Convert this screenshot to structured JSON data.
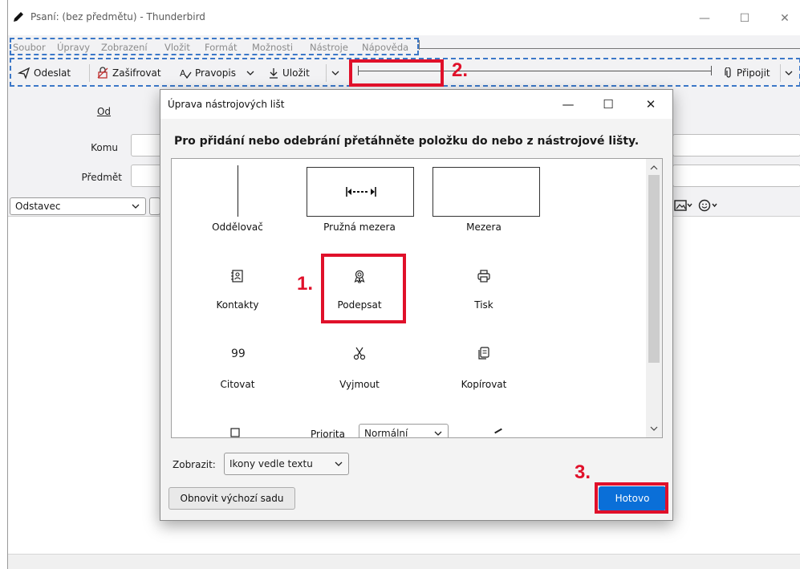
{
  "window": {
    "title": "Psaní: (bez předmětu) - Thunderbird",
    "minimize": "—",
    "maximize": "☐",
    "close": "✕"
  },
  "menubar": {
    "items": [
      "Soubor",
      "Úpravy",
      "Zobrazení",
      "Vložit",
      "Formát",
      "Možnosti",
      "Nástroje",
      "Nápověda"
    ]
  },
  "toolbar": {
    "send": "Odeslat",
    "encrypt": "Zašifrovat",
    "spelling": "Pravopis",
    "save": "Uložit",
    "attach": "Připojit"
  },
  "compose": {
    "from_label": "Od",
    "to_label": "Komu",
    "subject_label": "Předmět",
    "paragraph_select": "Odstavec"
  },
  "dialog": {
    "title": "Úprava nástrojových lišt",
    "minimize": "—",
    "maximize": "☐",
    "close": "✕",
    "instruction": "Pro přidání nebo odebrání přetáhněte položku do nebo z nástrojové lišty.",
    "items": [
      {
        "label": "Oddělovač",
        "icon": "separator-icon"
      },
      {
        "label": "Pružná mezera",
        "icon": "flexible-space-icon"
      },
      {
        "label": "Mezera",
        "icon": "space-icon"
      },
      {
        "label": "Kontakty",
        "icon": "contacts-icon"
      },
      {
        "label": "Podepsat",
        "icon": "sign-icon"
      },
      {
        "label": "Tisk",
        "icon": "print-icon"
      },
      {
        "label": "Citovat",
        "icon": "quote-icon"
      },
      {
        "label": "Vyjmout",
        "icon": "scissors-icon"
      },
      {
        "label": "Kopírovat",
        "icon": "copy-icon"
      }
    ],
    "partial_row_text": "Priorita",
    "partial_row_select": "Normální",
    "show_label": "Zobrazit:",
    "show_value": "Ikony vedle textu",
    "restore_button": "Obnovit výchozí sadu",
    "done_button": "Hotovo"
  },
  "annotations": {
    "step1": "1.",
    "step2": "2.",
    "step3": "3.",
    "color": "#e0102a"
  }
}
